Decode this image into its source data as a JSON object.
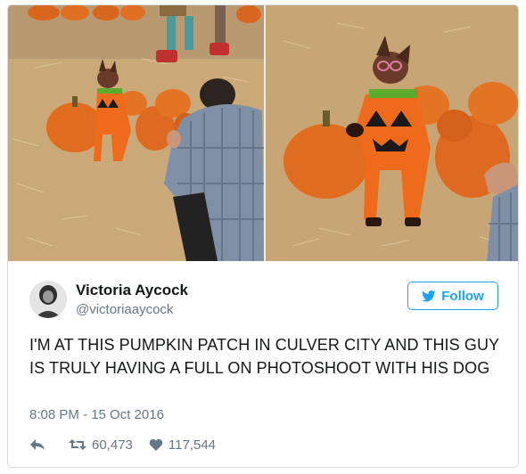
{
  "tweet": {
    "author": {
      "name": "Victoria Aycock",
      "handle": "@victoriaaycock"
    },
    "follow_label": "Follow",
    "text": "I'M AT THIS PUMPKIN PATCH IN CULVER CITY AND THIS GUY IS TRULY HAVING A FULL ON PHOTOSHOOT WITH HIS DOG",
    "timestamp": "8:08 PM - 15 Oct 2016",
    "retweets": "60,473",
    "likes": "117,544"
  },
  "icons": {
    "reply": "reply-icon",
    "retweet": "retweet-icon",
    "like": "heart-icon",
    "follow": "twitter-bird-icon"
  },
  "colors": {
    "accent": "#1da1f2",
    "secondary_text": "#657786"
  }
}
